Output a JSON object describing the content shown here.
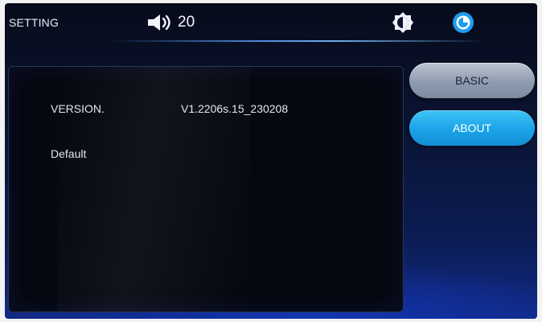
{
  "header": {
    "title": "SETTING",
    "volume": {
      "icon": "speaker-icon",
      "level": "20"
    },
    "brightness_icon": "brightness-icon",
    "theme_icon": "theme-icon"
  },
  "panel": {
    "rows": [
      {
        "label": "VERSION.",
        "value": "V1.2206s.15_230208"
      },
      {
        "label": "Default",
        "value": ""
      }
    ]
  },
  "side_menu": {
    "buttons": [
      {
        "label": "BASIC",
        "state": "inactive"
      },
      {
        "label": "ABOUT",
        "state": "active"
      }
    ]
  },
  "colors": {
    "active_button": "#1aa3e8",
    "inactive_button": "#9aa6b8",
    "accent_icon": "#1e9cf0"
  }
}
